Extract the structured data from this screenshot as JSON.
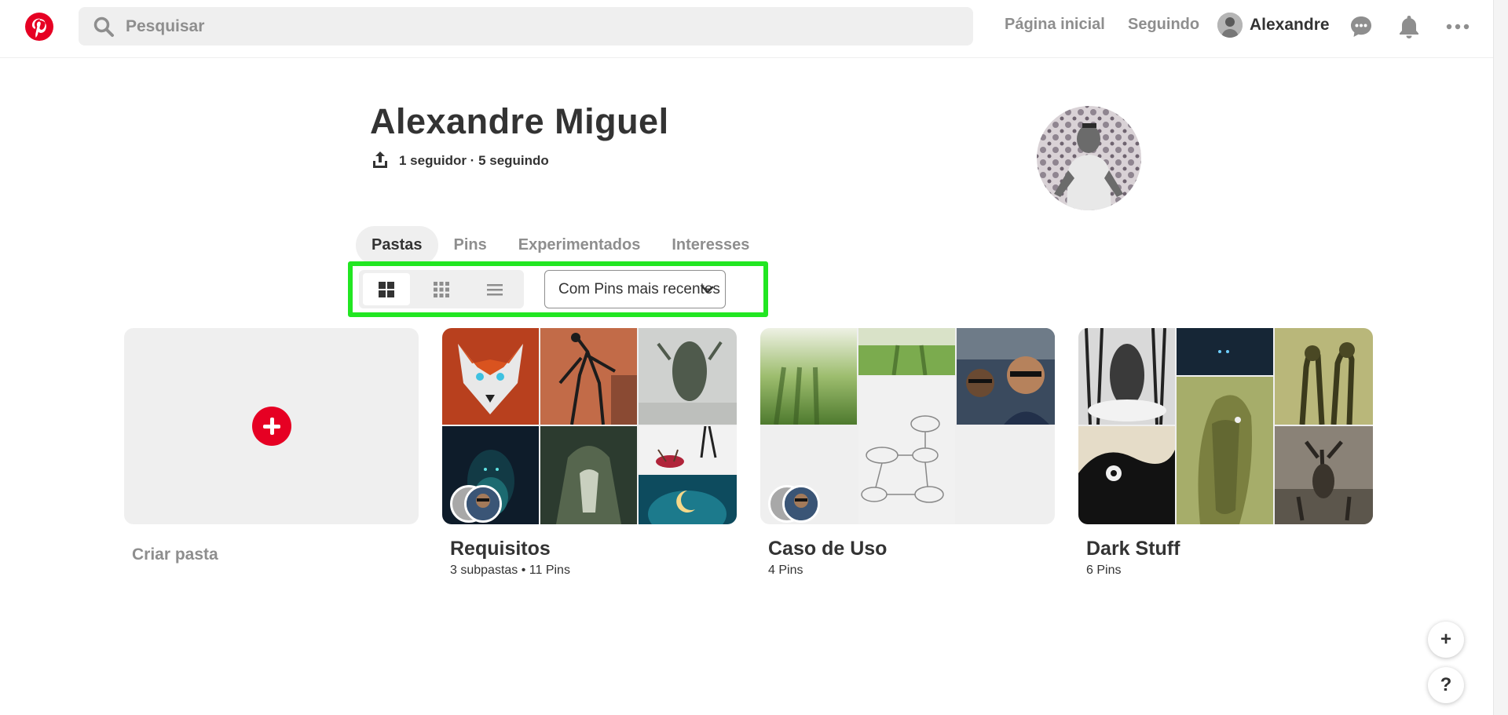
{
  "brand": {
    "color": "#e60023",
    "logo_icon": "pinterest-logo-icon"
  },
  "search": {
    "placeholder": "Pesquisar",
    "icon": "search-icon"
  },
  "nav": {
    "home_label": "Página inicial",
    "following_label": "Seguindo",
    "user_label": "Alexandre",
    "icons": [
      "chat-bubble-icon",
      "bell-icon",
      "more-dots-icon"
    ]
  },
  "profile": {
    "name": "Alexandre Miguel",
    "stats": "1 seguidor · 5 seguindo",
    "share_icon": "share-icon"
  },
  "tabs": [
    {
      "label": "Pastas",
      "active": true
    },
    {
      "label": "Pins",
      "active": false
    },
    {
      "label": "Experimentados",
      "active": false
    },
    {
      "label": "Interesses",
      "active": false
    }
  ],
  "view_options": {
    "modes": [
      "default-grid-icon",
      "compact-grid-icon",
      "list-icon"
    ],
    "active_mode": "default-grid-icon",
    "sort_selected": "Com Pins mais recentes",
    "highlight_color": "#22e622"
  },
  "boards": [
    {
      "title": "Criar pasta",
      "kind": "create"
    },
    {
      "title": "Requisitos",
      "meta": "3 subpastas • 11 Pins"
    },
    {
      "title": "Caso de Uso",
      "meta": "4 Pins"
    },
    {
      "title": "Dark Stuff",
      "meta": "6 Pins"
    }
  ],
  "floating": {
    "add_label": "+",
    "help_label": "?"
  }
}
